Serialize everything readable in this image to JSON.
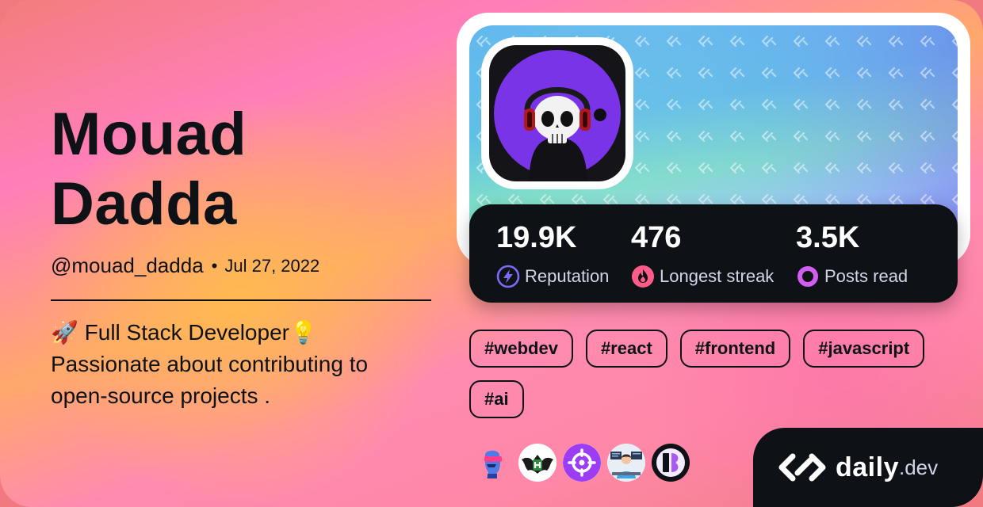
{
  "profile": {
    "first_name": "Mouad",
    "last_name": "Dadda",
    "handle": "@mouad_dadda",
    "separator": "•",
    "joined": "Jul 27, 2022",
    "bio_line1": "🚀 Full Stack Developer💡",
    "bio_line2": "Passionate about contributing to",
    "bio_line3": "open-source projects ."
  },
  "stats": [
    {
      "value": "19.9K",
      "label": "Reputation",
      "icon": "reputation-bolt-icon",
      "color": "#7c6af6"
    },
    {
      "value": "476",
      "label": "Longest streak",
      "icon": "streak-flame-icon",
      "color": "#ff5c8a"
    },
    {
      "value": "3.5K",
      "label": "Posts read",
      "icon": "posts-read-ring-icon",
      "color": "#d15ef0"
    }
  ],
  "tags": [
    "#webdev",
    "#react",
    "#frontend",
    "#javascript",
    "#ai"
  ],
  "squads": [
    {
      "icon": "squad-statue-icon"
    },
    {
      "icon": "squad-bat-icon"
    },
    {
      "icon": "squad-target-icon"
    },
    {
      "icon": "squad-workspace-icon"
    },
    {
      "icon": "squad-letter-icon"
    }
  ],
  "brand": {
    "name": "daily",
    "tld": ".dev",
    "icon": "daily-dev-logo-icon"
  },
  "colors": {
    "ink": "#0e1217",
    "card_white": "#ffffff"
  }
}
